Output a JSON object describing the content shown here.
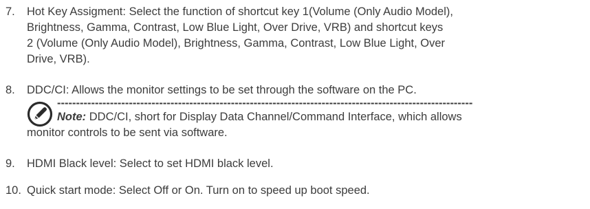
{
  "items": [
    {
      "number": "7.",
      "lines": [
        "Hot Key Assigment: Select the function of shortcut key 1(Volume (Only Audio Model),",
        "Brightness,  Gamma, Contrast, Low Blue Light, Over Drive, VRB) and shortcut keys",
        "2 (Volume (Only Audio Model), Brightness, Gamma, Contrast, Low Blue Light, Over",
        "Drive, VRB)."
      ]
    },
    {
      "number": "8.",
      "lines": [
        "DDC/CI: Allows the monitor settings to be set through the software on the PC."
      ]
    },
    {
      "number": "9.",
      "lines": [
        "HDMI Black level: Select to set HDMI black level."
      ]
    },
    {
      "number": "10.",
      "lines": [
        "Quick start mode: Select Off or On. Turn on to speed up boot speed."
      ]
    }
  ],
  "note": {
    "icon": "note-pencil-icon",
    "separator": "--------------------------------------------------------------------------------------------------------------",
    "label": "Note:",
    "line1_rest": " DDC/CI, short for Display Data Channel/Command Interface, which allows",
    "line2": "monitor controls to be sent via software."
  },
  "colors": {
    "text": "#3c3c3c"
  }
}
